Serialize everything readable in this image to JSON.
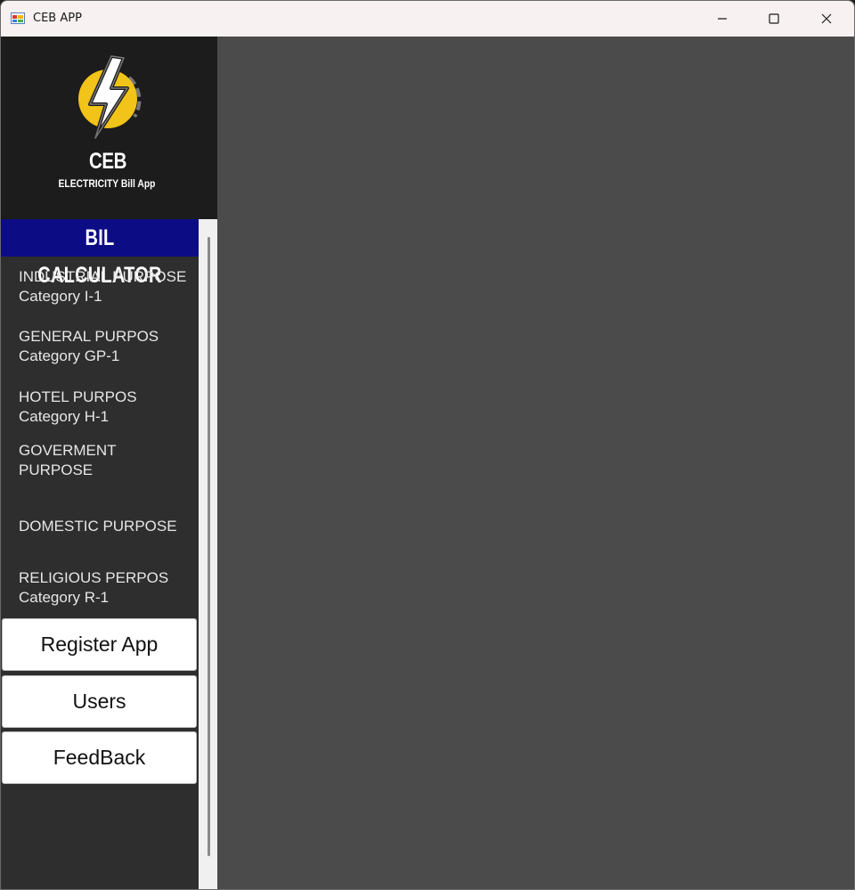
{
  "window": {
    "title": "CEB APP",
    "controls": {
      "minimize": "minimize-icon",
      "maximize": "maximize-icon",
      "close": "close-icon"
    }
  },
  "brand": {
    "name": "CEB",
    "subtitle": "ELECTRICITY Bill App",
    "logo_icon": "lightning-bolt-icon",
    "logo_color": "#f2c318"
  },
  "sidebar": {
    "header": "BIL CALCULATOR",
    "header_color": "#0c0c85",
    "items": [
      {
        "title": "INDUSTRIAL PURPOSE",
        "subtitle": "Category I-1"
      },
      {
        "title": "GENERAL PURPOS",
        "subtitle": "Category GP-1"
      },
      {
        "title": "HOTEL PURPOS",
        "subtitle": "Category H-1"
      },
      {
        "title": "GOVERMENT PURPOSE",
        "subtitle": ""
      },
      {
        "title": "DOMESTIC PURPOSE",
        "subtitle": ""
      },
      {
        "title": "RELIGIOUS PERPOS",
        "subtitle": "Category R-1"
      }
    ],
    "buttons": {
      "register": "Register App",
      "users": "Users",
      "feedback": "FeedBack"
    }
  }
}
